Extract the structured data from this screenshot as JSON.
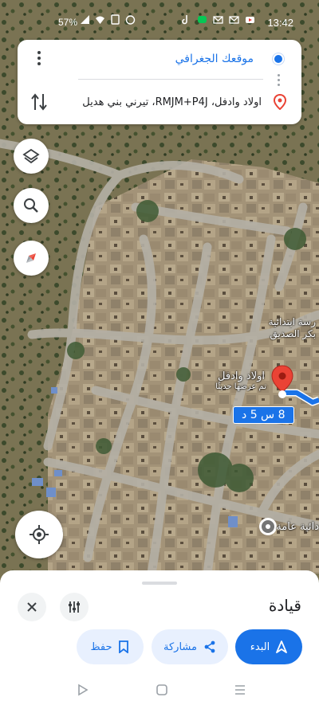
{
  "status_bar": {
    "time": "13:42",
    "battery": "57%"
  },
  "route_card": {
    "origin": "موقعك الجغرافي",
    "destination": "اولاد وادفل، RMJM+P4J، تيرني بني هديل"
  },
  "map": {
    "destination_label_line1": "اولاد وادفل",
    "destination_label_line2": "تم عرضها حديثًا",
    "school_label_line1": "رسة ابتدائية",
    "school_label_line2": "بكر الصديق",
    "poi_label": "دائية عامة",
    "eta_badge": "8 س 5 د"
  },
  "bottom_sheet": {
    "title": "قيادة",
    "save_label": "حفظ",
    "share_label": "مشاركة",
    "start_label": "البدء"
  },
  "colors": {
    "accent": "#1a73e8",
    "pin_red": "#ea4335"
  }
}
